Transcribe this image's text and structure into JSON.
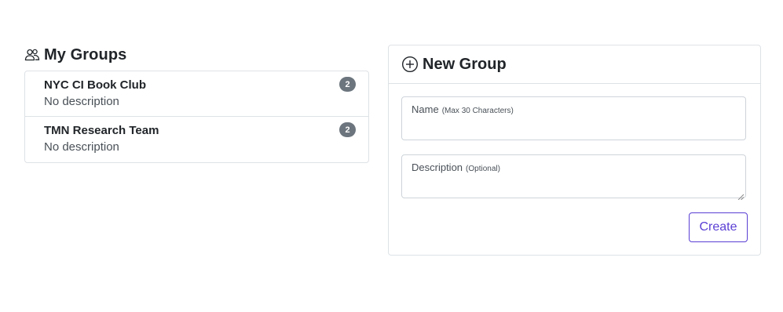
{
  "my_groups": {
    "title": "My Groups",
    "icon": "people-icon",
    "items": [
      {
        "name": "NYC CI Book Club",
        "description": "No description",
        "member_count": "2"
      },
      {
        "name": "TMN Research Team",
        "description": "No description",
        "member_count": "2"
      }
    ]
  },
  "new_group": {
    "title": "New Group",
    "icon": "plus-circle-icon",
    "name_field": {
      "label": "Name",
      "hint": "(Max 30 Characters)",
      "value": ""
    },
    "description_field": {
      "label": "Description",
      "hint": "(Optional)",
      "value": ""
    },
    "create_label": "Create"
  },
  "colors": {
    "accent": "#5b3fd4",
    "badge": "#6c757d",
    "border": "#dee2e6"
  }
}
